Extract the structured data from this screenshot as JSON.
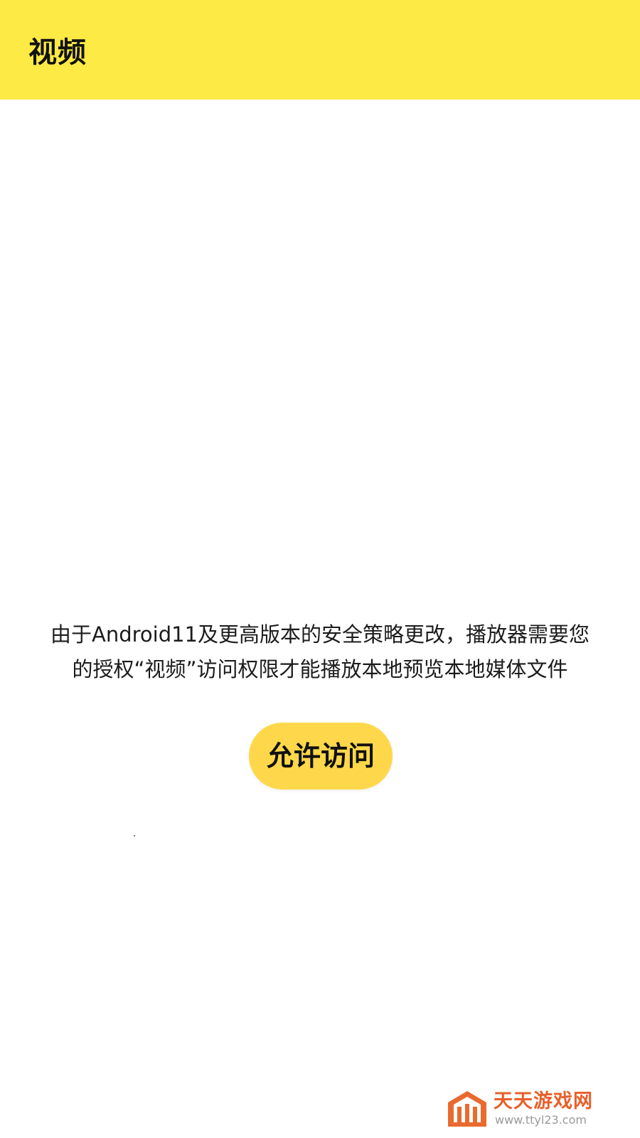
{
  "header": {
    "title": "视频",
    "background_color": "#fdea44"
  },
  "permission_prompt": {
    "message_lines": [
      "由于Android11及更高版本的安全策略更改，播放器需要您",
      "的授权“视频”访问权限才能播放本地预览本地媒体文件"
    ],
    "button_label": "允许访问",
    "button_color": "#fed84a"
  },
  "watermark": {
    "icon": "house-logo-icon",
    "name": "天天游戏网",
    "url": "www.ttyl23.com",
    "color": "#e7602a"
  }
}
